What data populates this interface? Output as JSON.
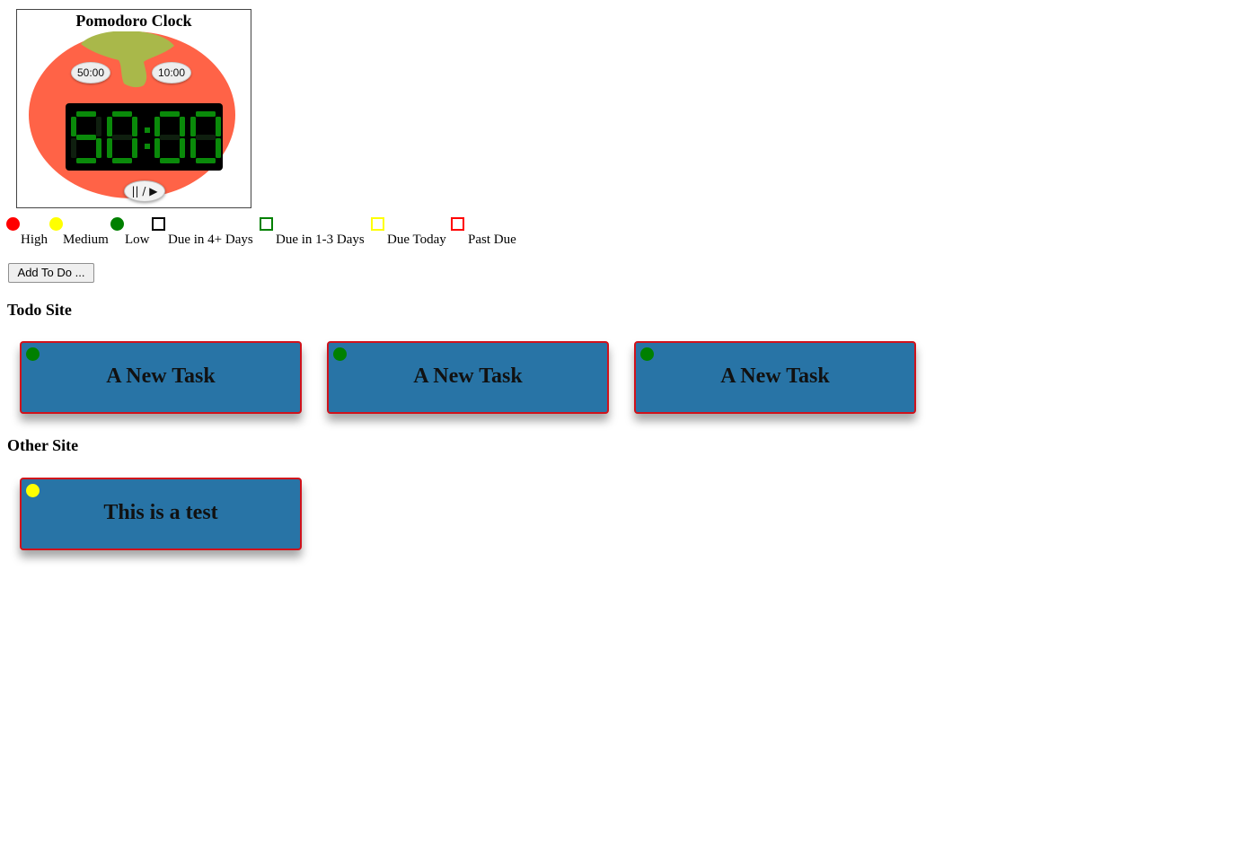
{
  "pomodoro": {
    "title": "Pomodoro Clock",
    "presets": [
      "50:00",
      "10:00"
    ],
    "display_time": "50:00",
    "play_pause_label": "|| / ▶"
  },
  "legend": [
    {
      "kind": "dot",
      "color": "#ff0000",
      "label": "High"
    },
    {
      "kind": "dot",
      "color": "#ffff00",
      "label": "Medium"
    },
    {
      "kind": "dot",
      "color": "#008000",
      "label": "Low"
    },
    {
      "kind": "square",
      "color": "#000000",
      "label": "Due in 4+ Days"
    },
    {
      "kind": "square",
      "color": "#008000",
      "label": "Due in 1-3 Days"
    },
    {
      "kind": "square",
      "color": "#ffff00",
      "label": "Due Today"
    },
    {
      "kind": "square",
      "color": "#ff0000",
      "label": "Past Due"
    }
  ],
  "add_button_label": "Add To Do ...",
  "groups": [
    {
      "title": "Todo Site",
      "tasks": [
        {
          "title": "A New Task",
          "priority_color": "#008000"
        },
        {
          "title": "A New Task",
          "priority_color": "#008000"
        },
        {
          "title": "A New Task",
          "priority_color": "#008000"
        }
      ]
    },
    {
      "title": "Other Site",
      "tasks": [
        {
          "title": "This is a test",
          "priority_color": "#ffff00"
        }
      ]
    }
  ],
  "colors": {
    "tomato": "#ff6347",
    "stem": "#a9b84a",
    "segment_on": "#0a8a0a",
    "segment_off": "#0f1f0f",
    "card_bg": "#2874a6",
    "card_border": "#d0121b"
  }
}
